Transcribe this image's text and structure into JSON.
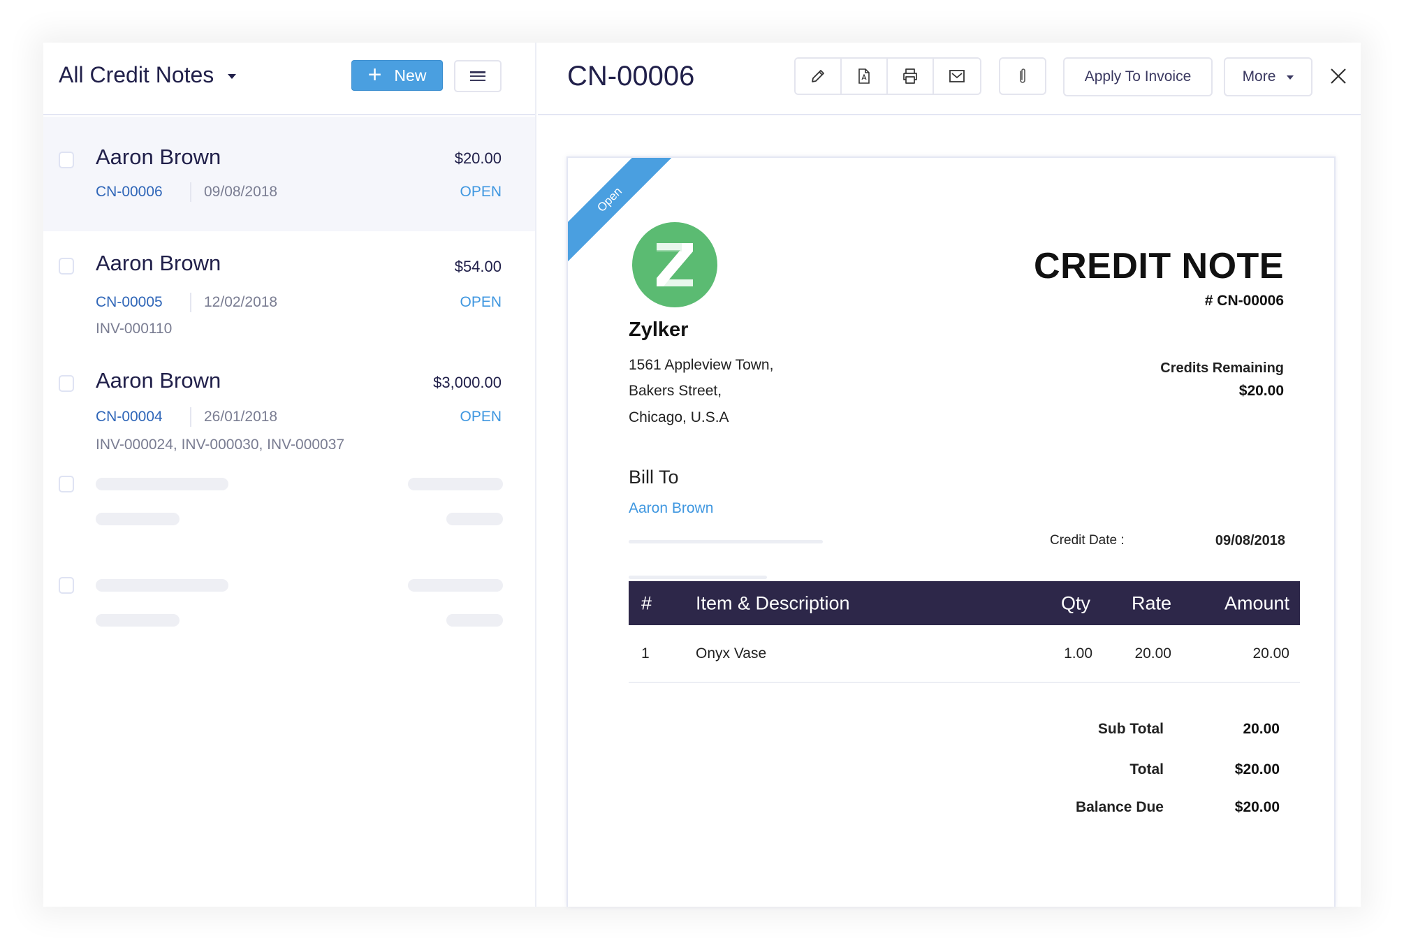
{
  "list_panel": {
    "view_title": "All Credit Notes",
    "new_button": "New",
    "items": [
      {
        "customer": "Aaron Brown",
        "amount": "$20.00",
        "number": "CN-00006",
        "date": "09/08/2018",
        "status": "OPEN",
        "invoices": "",
        "selected": true
      },
      {
        "customer": "Aaron Brown",
        "amount": "$54.00",
        "number": "CN-00005",
        "date": "12/02/2018",
        "status": "OPEN",
        "invoices": "INV-000110",
        "selected": false
      },
      {
        "customer": "Aaron Brown",
        "amount": "$3,000.00",
        "number": "CN-00004",
        "date": "26/01/2018",
        "status": "OPEN",
        "invoices": "INV-000024, INV-000030, INV-000037",
        "selected": false
      }
    ]
  },
  "detail_header": {
    "title": "CN-00006",
    "toolbar_icons": [
      "edit-icon",
      "pdf-icon",
      "print-icon",
      "email-icon"
    ],
    "attach_icon": "attachment-icon",
    "apply_button": "Apply To Invoice",
    "more_button": "More"
  },
  "document": {
    "ribbon": "Open",
    "logo_letter": "Z",
    "company": "Zylker",
    "address": [
      "1561 Appleview Town,",
      "Bakers Street,",
      "Chicago, U.S.A"
    ],
    "title": "CREDIT NOTE",
    "number": "# CN-00006",
    "credits_remaining_label": "Credits Remaining",
    "credits_remaining_value": "$20.00",
    "bill_to_label": "Bill To",
    "bill_to_name": "Aaron Brown",
    "credit_date_label": "Credit Date :",
    "credit_date_value": "09/08/2018",
    "table": {
      "headers": {
        "num": "#",
        "item": "Item & Description",
        "qty": "Qty",
        "rate": "Rate",
        "amount": "Amount"
      },
      "rows": [
        {
          "num": "1",
          "item": "Onyx Vase",
          "qty": "1.00",
          "rate": "20.00",
          "amount": "20.00"
        }
      ]
    },
    "totals": [
      {
        "label": "Sub Total",
        "value": "20.00"
      },
      {
        "label": "Total",
        "value": "$20.00"
      },
      {
        "label": "Balance Due",
        "value": "$20.00"
      }
    ]
  },
  "colors": {
    "accent": "#4a9fe0",
    "table_header": "#2d2749",
    "logo": "#5bbb72",
    "link": "#2f66b8"
  }
}
